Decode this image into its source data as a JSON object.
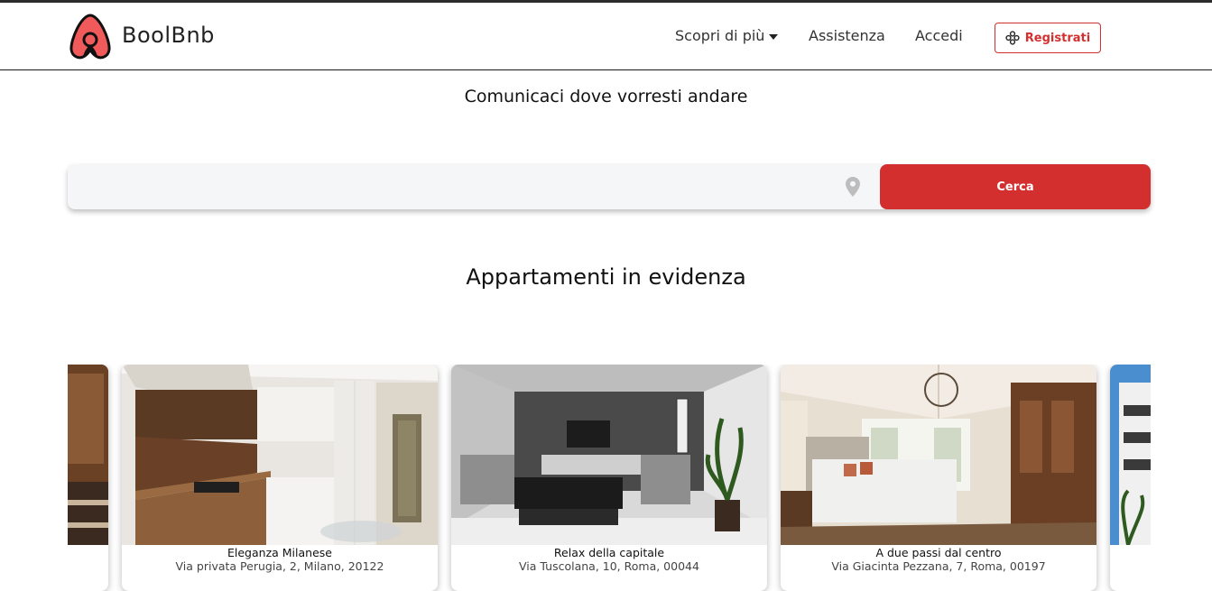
{
  "header": {
    "brand": "BoolBnb",
    "nav": {
      "discover": "Scopri di più",
      "help": "Assistenza",
      "login": "Accedi",
      "register": "Registrati"
    }
  },
  "hero": {
    "prompt": "Comunicaci dove vorresti andare",
    "search": {
      "placeholder": "",
      "button_label": "Cerca"
    }
  },
  "featured": {
    "title": "Appartamenti in evidenza",
    "cards": [
      {
        "title": "Eleganza Milanese",
        "address": "Via privata Perugia, 2, Milano, 20122"
      },
      {
        "title": "Relax della capitale",
        "address": "Via Tuscolana, 10, Roma, 00044"
      },
      {
        "title": "A due passi dal centro",
        "address": "Via Giacinta Pezzana, 7, Roma, 00197"
      }
    ]
  },
  "colors": {
    "accent": "#d32f2f",
    "search_bg": "#f5f6f8"
  },
  "icons": {
    "logo": "airbnb-logo-icon",
    "location": "map-pin-icon",
    "register": "gamepad-icon",
    "caret": "caret-down-icon"
  }
}
